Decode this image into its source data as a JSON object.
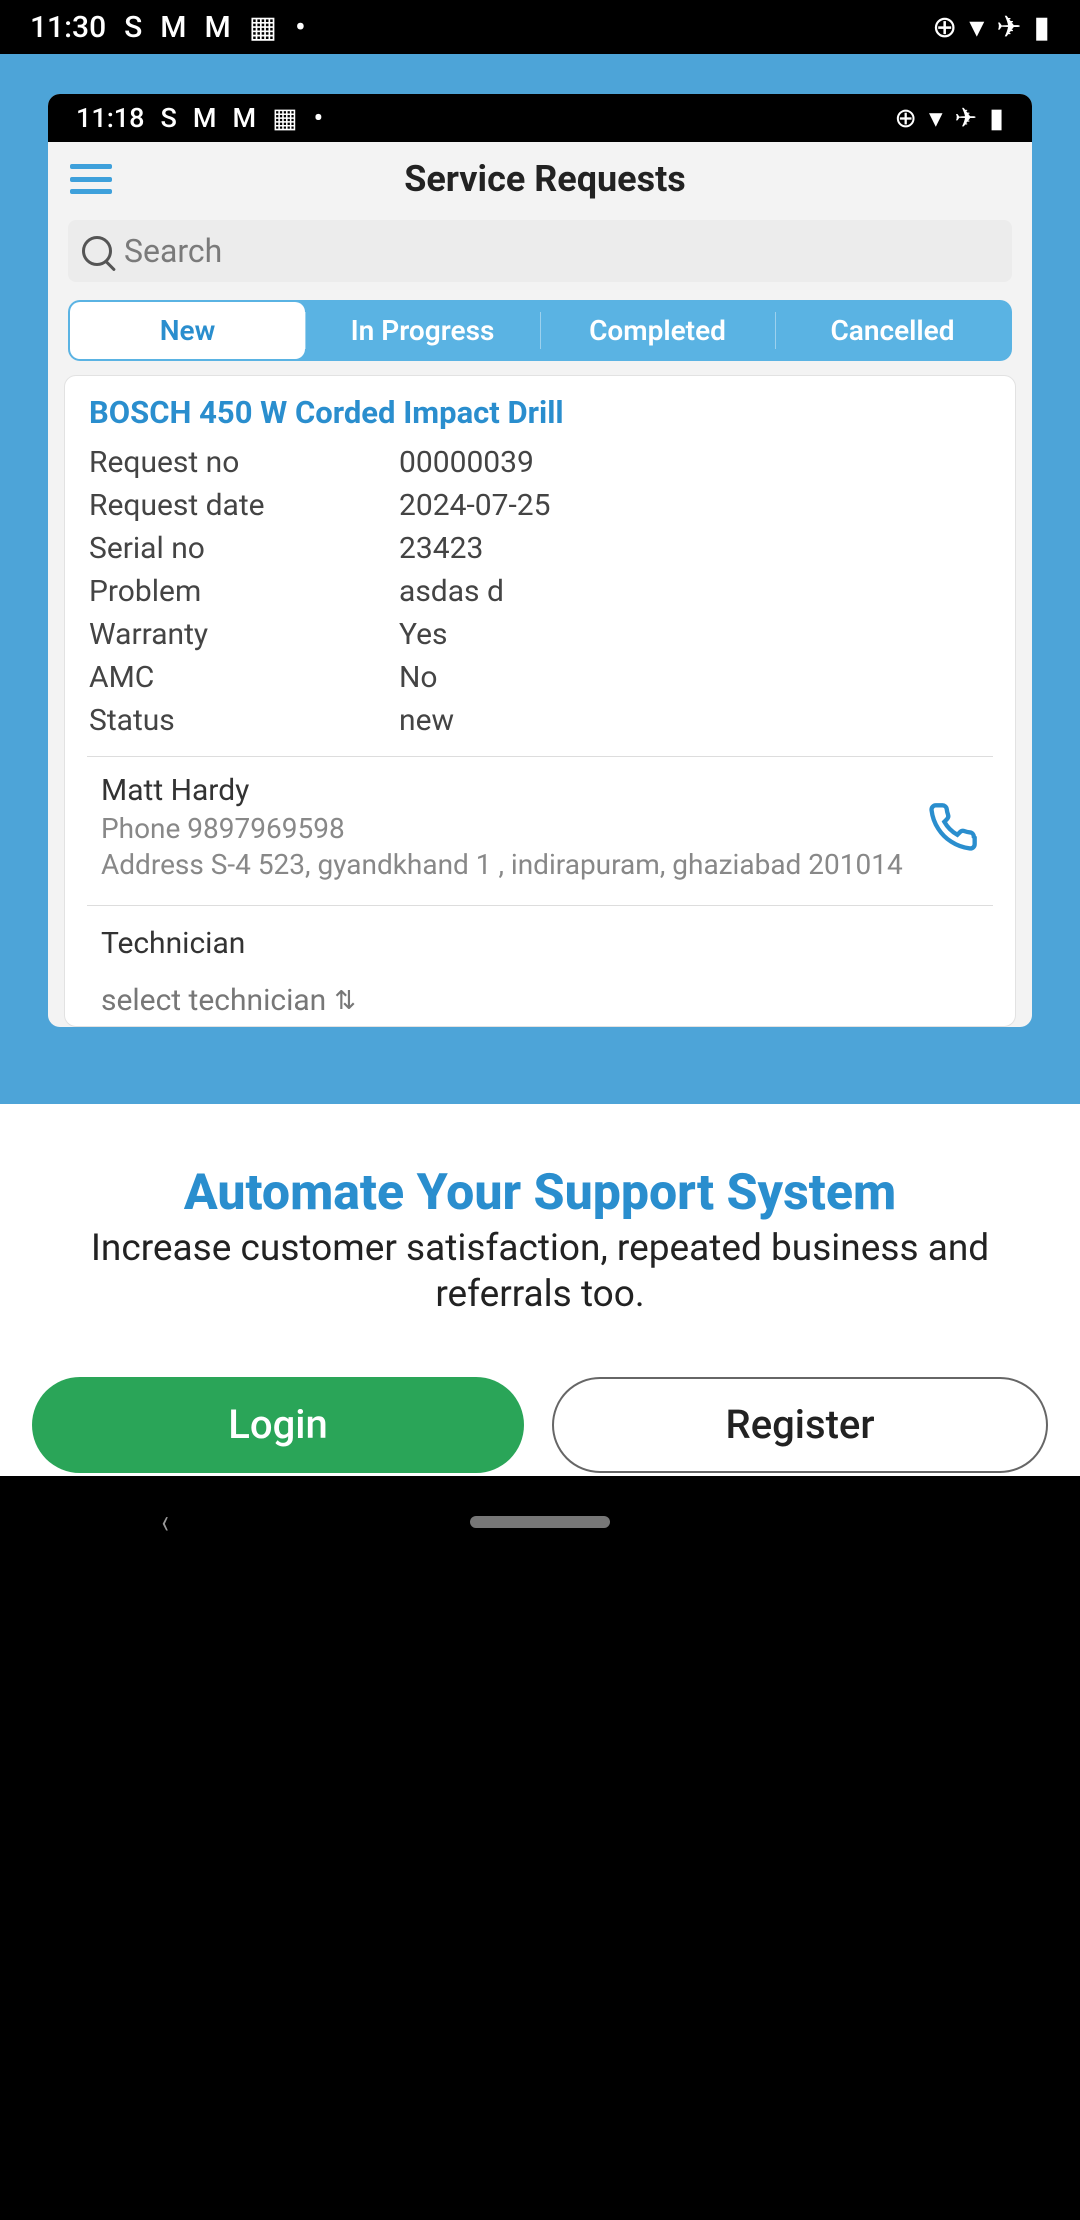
{
  "outerStatus": {
    "time": "11:30",
    "icons": [
      "S",
      "M",
      "M",
      "▦",
      "•"
    ],
    "rightIcons": [
      "⊕",
      "wifi",
      "plane",
      "battery"
    ]
  },
  "innerStatus": {
    "time": "11:18",
    "icons": [
      "S",
      "M",
      "M",
      "▦",
      "•"
    ],
    "rightIcons": [
      "⊕",
      "wifi",
      "plane",
      "battery"
    ]
  },
  "header": {
    "title": "Service Requests"
  },
  "search": {
    "placeholder": "Search"
  },
  "tabs": [
    {
      "label": "New",
      "active": true
    },
    {
      "label": "In Progress",
      "active": false
    },
    {
      "label": "Completed",
      "active": false
    },
    {
      "label": "Cancelled",
      "active": false
    }
  ],
  "request": {
    "product": "BOSCH 450 W Corded Impact Drill",
    "rows": [
      {
        "label": "Request no",
        "value": "00000039"
      },
      {
        "label": "Request date",
        "value": "2024-07-25"
      },
      {
        "label": "Serial no",
        "value": "23423"
      },
      {
        "label": "Problem",
        "value": "asdas d"
      },
      {
        "label": "Warranty",
        "value": "Yes"
      },
      {
        "label": "AMC",
        "value": "No"
      },
      {
        "label": "Status",
        "value": "new"
      }
    ],
    "customer": {
      "name": "Matt Hardy",
      "phoneLabel": "Phone 9897969598",
      "addressLabel": "Address S-4 523, gyandkhand 1 , indirapuram, ghaziabad 201014"
    },
    "technician": {
      "label": "Technician",
      "placeholder": "select technician"
    }
  },
  "promo": {
    "title": "Automate Your Support System",
    "subtitle": "Increase customer satisfaction, repeated business and referrals too.",
    "loginLabel": "Login",
    "registerLabel": "Register"
  },
  "colors": {
    "accentBlue": "#2a8ece",
    "skyPanel": "#4da4d8",
    "ctaGreen": "#2aa558"
  }
}
